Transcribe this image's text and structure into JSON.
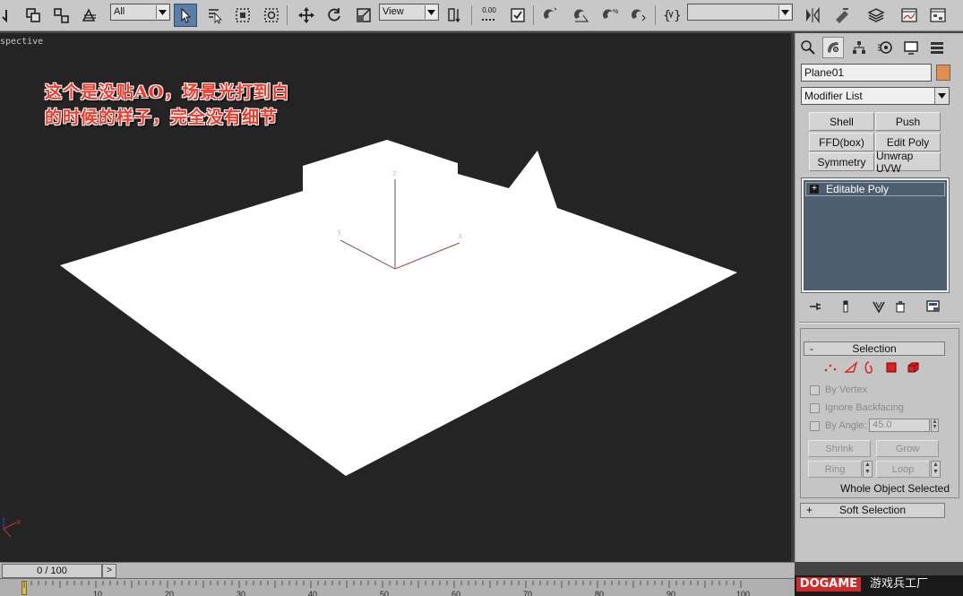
{
  "toolbar": {
    "selection_filter": "All",
    "reference_coord": "View",
    "snap_value": "0.00",
    "named_selection": ""
  },
  "viewport": {
    "label": "spective",
    "annotation_line1": "这个是没贴AO，场景光打到白",
    "annotation_line2": "的时候的样子，完全没有细节",
    "axis_x": "x",
    "axis_y": "y",
    "axis_z": "z",
    "colors": {
      "background": "#242424",
      "geometry": "#ffffff",
      "annotation": "#f23a2a"
    }
  },
  "panel": {
    "object_name": "Plane01",
    "object_color": "#e58c4f",
    "modifier_list": "Modifier List",
    "modifier_buttons": [
      "Shell",
      "Push",
      "FFD(box)",
      "Edit Poly",
      "Symmetry",
      "Unwrap UVW"
    ],
    "stack_item": "Editable Poly",
    "selection": {
      "title": "Selection",
      "collapse_sign": "-",
      "by_vertex": "By Vertex",
      "ignore_backfacing": "Ignore Backfacing",
      "by_angle": "By Angle:",
      "angle_value": "45.0",
      "shrink": "Shrink",
      "grow": "Grow",
      "ring": "Ring",
      "loop": "Loop",
      "status": "Whole Object Selected"
    },
    "soft_selection": {
      "title": "Soft Selection",
      "expand_sign": "+"
    }
  },
  "timeline": {
    "frame_display": "0 / 100",
    "next_label": ">",
    "ticks": [
      "10",
      "20",
      "30",
      "40",
      "50",
      "60",
      "70",
      "80",
      "90",
      "100"
    ]
  },
  "brand": {
    "logo": "DOGAME",
    "name": "游戏兵工厂"
  }
}
